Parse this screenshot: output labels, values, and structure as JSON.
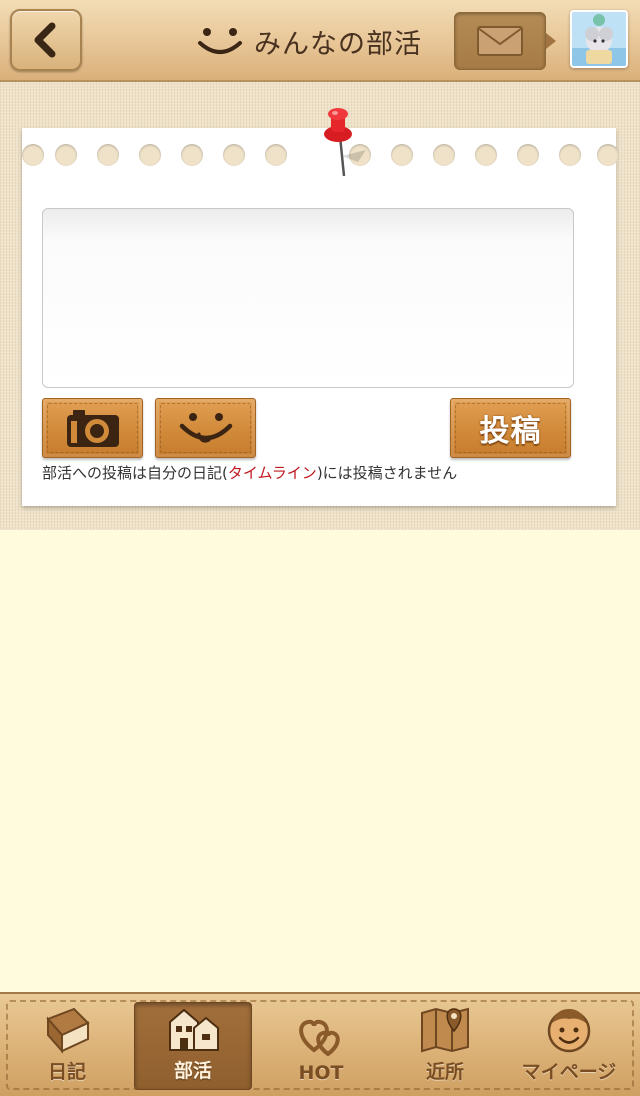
{
  "header": {
    "title": "みんなの部活",
    "back_icon": "chevron-left-icon",
    "mail_icon": "envelope-icon",
    "avatar_icon": "user-avatar"
  },
  "composer": {
    "placeholder": "",
    "value": "",
    "camera_icon": "camera-icon",
    "emoji_icon": "smiley-icon",
    "post_label": "投稿",
    "note_before": "部活への投稿は自分の日記(",
    "note_highlight": "タイムライン",
    "note_after": ")には投稿されません",
    "highlight_color": "#c0191f"
  },
  "tabs": [
    {
      "label": "日記",
      "icon": "diary-book-icon",
      "active": false
    },
    {
      "label": "部活",
      "icon": "club-building-icon",
      "active": true
    },
    {
      "label": "HOT",
      "icon": "hearts-icon",
      "active": false
    },
    {
      "label": "近所",
      "icon": "map-pin-icon",
      "active": false
    },
    {
      "label": "マイページ",
      "icon": "face-icon",
      "active": false
    }
  ],
  "colors": {
    "background": "#fffcdd",
    "wood_button": "#d18a3a",
    "header_text": "#4a3220"
  }
}
